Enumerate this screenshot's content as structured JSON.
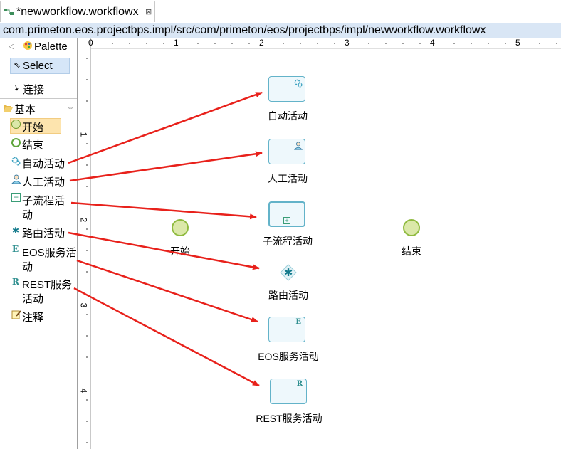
{
  "tab": {
    "title": "*newworkflow.workflowx",
    "close": "⊠",
    "icon": "workflow-icon"
  },
  "path": "com.primeton.eos.projectbps.impl/src/com/primeton/eos/projectbps/impl/newworkflow.workflowx",
  "palette": {
    "title": "Palette",
    "select": "Select",
    "connect": "连接",
    "group": "基本",
    "items": [
      "开始",
      "结束",
      "自动活动",
      "人工活动",
      "子流程活",
      "动",
      "路由活动",
      "EOS服务活",
      "动",
      "REST服务",
      "活动",
      "注释"
    ]
  },
  "ruler": {
    "h": [
      "0",
      "1",
      "2",
      "3",
      "4",
      "5"
    ],
    "v": [
      "1",
      "2",
      "3",
      "4"
    ]
  },
  "nodes": {
    "auto": "自动活动",
    "manual": "人工活动",
    "subprocess": "子流程活动",
    "route": "路由活动",
    "eos": "EOS服务活动",
    "rest": "REST服务活动",
    "start": "开始",
    "end": "结束"
  },
  "colors": {
    "arrow": "#e8211b",
    "activity_border": "#63b3c9",
    "event_fill": "#dbe8a9",
    "path_bg": "#d9e6f5"
  }
}
